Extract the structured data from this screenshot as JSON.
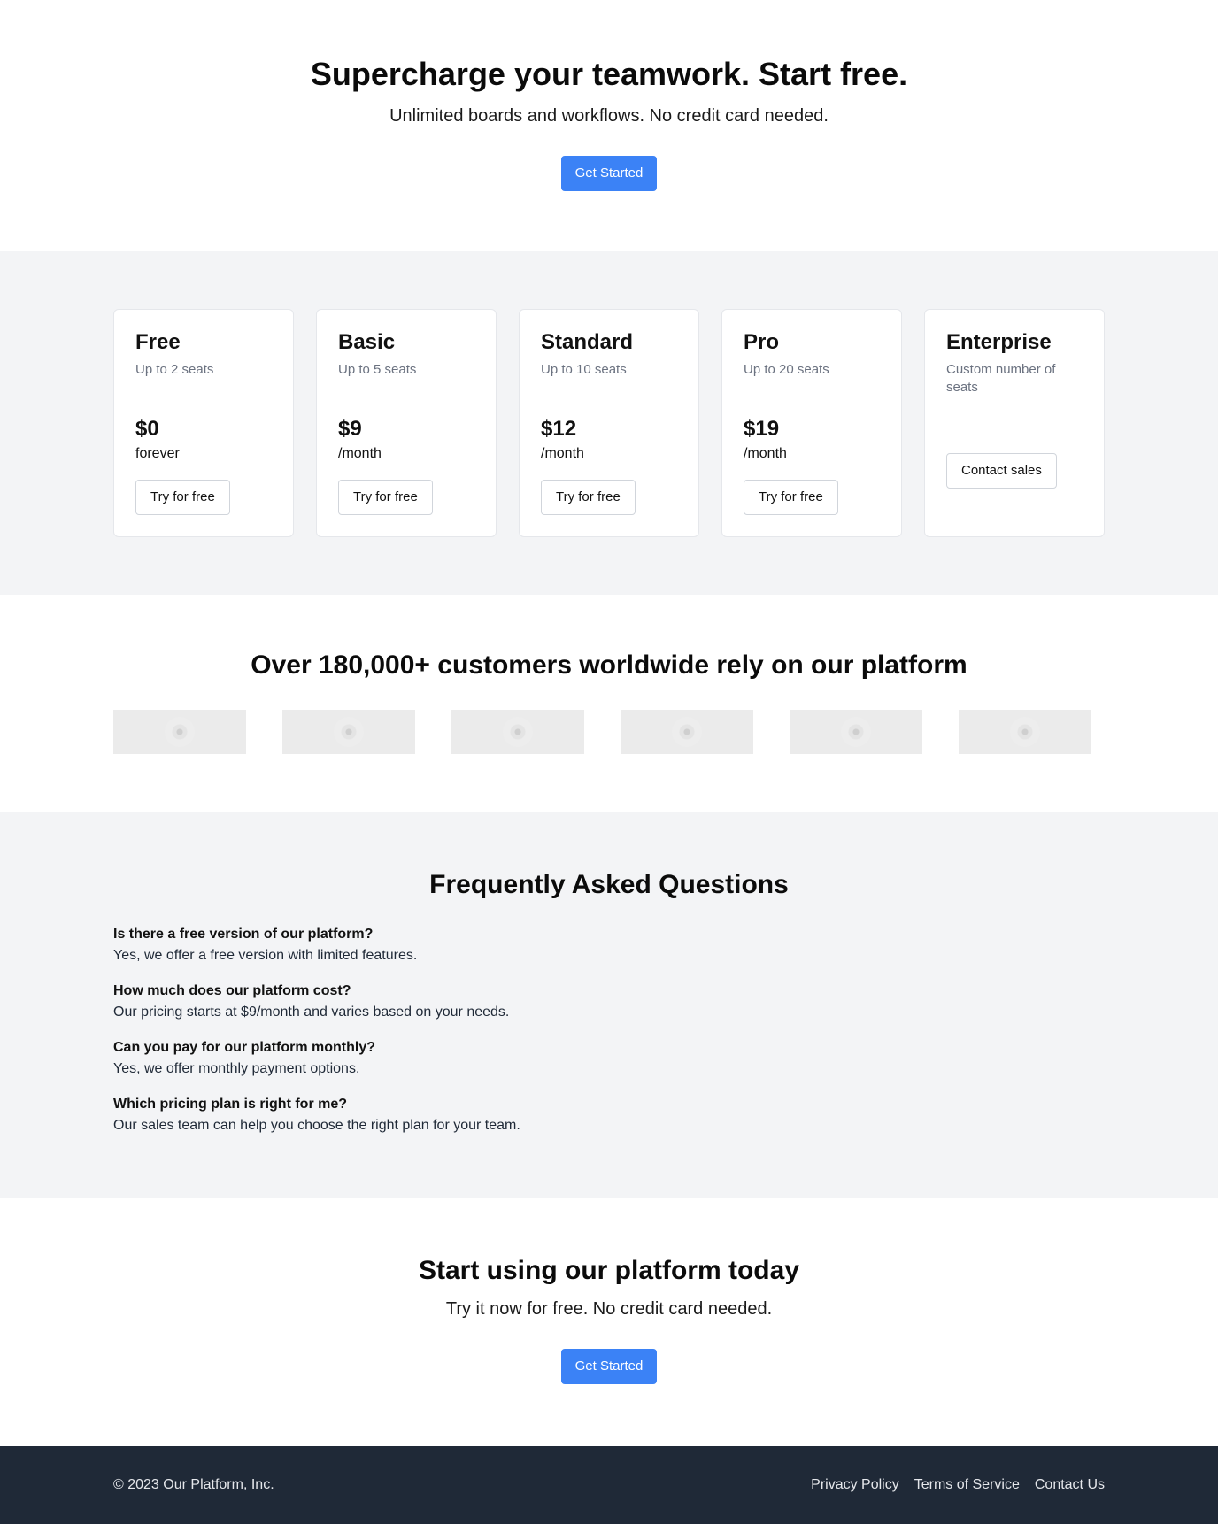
{
  "hero": {
    "title": "Supercharge your teamwork. Start free.",
    "subtitle": "Unlimited boards and workflows. No credit card needed.",
    "cta_label": "Get Started"
  },
  "plans": [
    {
      "name": "Free",
      "seats": "Up to 2 seats",
      "price": "$0",
      "period": "forever",
      "button": "Try for free"
    },
    {
      "name": "Basic",
      "seats": "Up to 5 seats",
      "price": "$9",
      "period": "/month",
      "button": "Try for free"
    },
    {
      "name": "Standard",
      "seats": "Up to 10 seats",
      "price": "$12",
      "period": "/month",
      "button": "Try for free"
    },
    {
      "name": "Pro",
      "seats": "Up to 20 seats",
      "price": "$19",
      "period": "/month",
      "button": "Try for free"
    },
    {
      "name": "Enterprise",
      "seats": "Custom number of seats",
      "button": "Contact sales"
    }
  ],
  "customers": {
    "title": "Over 180,000+ customers worldwide rely on our platform",
    "logo_count": 6
  },
  "faq": {
    "title": "Frequently Asked Questions",
    "items": [
      {
        "q": "Is there a free version of our platform?",
        "a": "Yes, we offer a free version with limited features."
      },
      {
        "q": "How much does our platform cost?",
        "a": "Our pricing starts at $9/month and varies based on your needs."
      },
      {
        "q": "Can you pay for our platform monthly?",
        "a": "Yes, we offer monthly payment options."
      },
      {
        "q": "Which pricing plan is right for me?",
        "a": "Our sales team can help you choose the right plan for your team."
      }
    ]
  },
  "cta": {
    "title": "Start using our platform today",
    "subtitle": "Try it now for free. No credit card needed.",
    "button": "Get Started"
  },
  "footer": {
    "copyright": "© 2023 Our Platform, Inc.",
    "links": [
      "Privacy Policy",
      "Terms of Service",
      "Contact Us"
    ]
  },
  "colors": {
    "primary": "#3b82f6",
    "section_gray": "#f3f4f6",
    "footer_bg": "#1f2937"
  }
}
